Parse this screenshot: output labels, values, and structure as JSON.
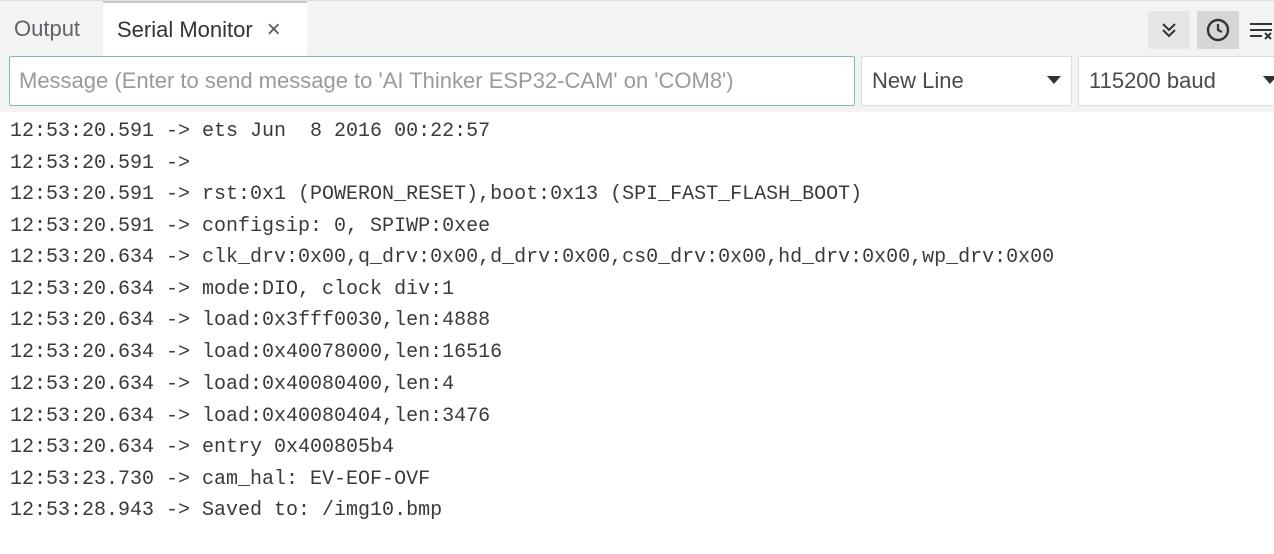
{
  "tabs": {
    "output": "Output",
    "serial_monitor": "Serial Monitor",
    "close_glyph": "×"
  },
  "toolbar": {
    "autoscroll_icon": "double-chevron-down-icon",
    "timestamp_icon": "clock-icon",
    "clear_icon": "clear-output-icon"
  },
  "message": {
    "placeholder": "Message (Enter to send message to 'AI Thinker ESP32-CAM' on 'COM8')",
    "value": ""
  },
  "line_ending": {
    "selected": "New Line"
  },
  "baud_rate": {
    "selected": "115200 baud"
  },
  "lines": [
    "12:53:20.591 -> ets Jun  8 2016 00:22:57",
    "12:53:20.591 -> ",
    "12:53:20.591 -> rst:0x1 (POWERON_RESET),boot:0x13 (SPI_FAST_FLASH_BOOT)",
    "12:53:20.591 -> configsip: 0, SPIWP:0xee",
    "12:53:20.634 -> clk_drv:0x00,q_drv:0x00,d_drv:0x00,cs0_drv:0x00,hd_drv:0x00,wp_drv:0x00",
    "12:53:20.634 -> mode:DIO, clock div:1",
    "12:53:20.634 -> load:0x3fff0030,len:4888",
    "12:53:20.634 -> load:0x40078000,len:16516",
    "12:53:20.634 -> load:0x40080400,len:4",
    "12:53:20.634 -> load:0x40080404,len:3476",
    "12:53:20.634 -> entry 0x400805b4",
    "12:53:23.730 -> cam_hal: EV-EOF-OVF",
    "12:53:28.943 -> Saved to: /img10.bmp"
  ]
}
